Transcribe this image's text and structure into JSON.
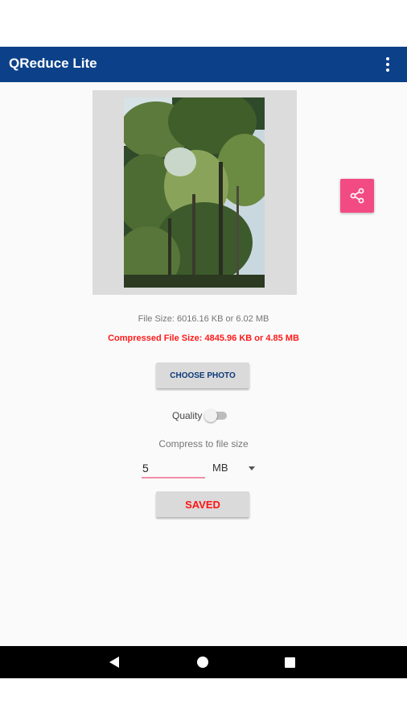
{
  "app_bar": {
    "title": "QReduce Lite",
    "background_color": "#0c4189",
    "overflow_icon": "more-vert-icon"
  },
  "preview": {
    "image_description_icon": "photo-of-trees"
  },
  "share_button": {
    "icon": "share-icon",
    "color": "#f24b84"
  },
  "file_info": {
    "original": "File Size: 6016.16 KB or 6.02 MB",
    "compressed": "Compressed File Size: 4845.96 KB or 4.85 MB",
    "compressed_color": "#ff1a1a"
  },
  "choose_button": {
    "label": "CHOOSE PHOTO"
  },
  "quality": {
    "label": "Quality",
    "enabled": false
  },
  "compress": {
    "label": "Compress to file size",
    "value": "5",
    "unit": "MB"
  },
  "saved_button": {
    "label": "SAVED"
  },
  "nav": {
    "back_icon": "back-icon",
    "home_icon": "home-icon",
    "recents_icon": "recents-icon"
  }
}
